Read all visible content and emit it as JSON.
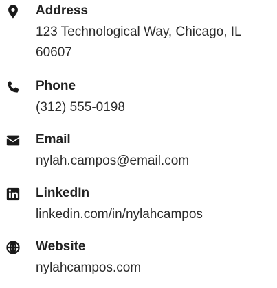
{
  "contact": {
    "address": {
      "label": "Address",
      "value": "123 Technological Way, Chicago, IL 60607",
      "icon": "map-marker-icon"
    },
    "phone": {
      "label": "Phone",
      "value": "(312) 555-0198",
      "icon": "phone-icon"
    },
    "email": {
      "label": "Email",
      "value": "nylah.campos@email.com",
      "icon": "envelope-icon"
    },
    "linkedin": {
      "label": "LinkedIn",
      "value": "linkedin.com/in/nylahcampos",
      "icon": "linkedin-icon"
    },
    "website": {
      "label": "Website",
      "value": "nylahcampos.com",
      "icon": "globe-icon"
    }
  },
  "colors": {
    "text": "#2b2b2b",
    "label": "#222222",
    "icon": "#1a1a1a"
  }
}
